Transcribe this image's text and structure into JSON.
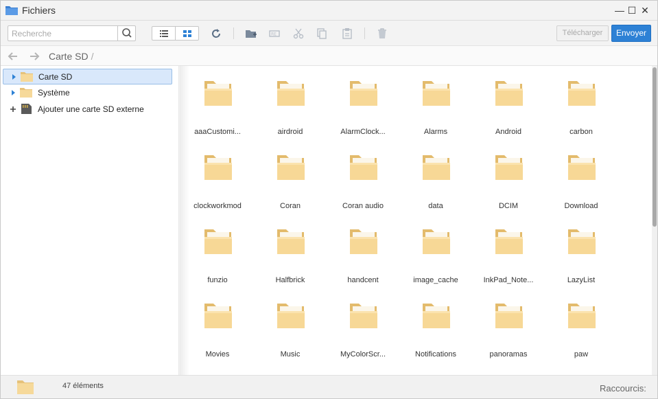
{
  "window": {
    "title": "Fichiers",
    "minimize_label": "—",
    "maximize_label": "☐",
    "close_label": "✕"
  },
  "toolbar": {
    "search_placeholder": "Recherche",
    "view_modes": [
      "list",
      "grid"
    ],
    "active_view": "grid",
    "icons": [
      "search-icon",
      "list-view-icon",
      "grid-view-icon",
      "refresh-icon",
      "new-folder-icon",
      "rename-icon",
      "cut-icon",
      "copy-icon",
      "paste-icon",
      "delete-icon"
    ],
    "download_label": "Télécharger",
    "send_label": "Envoyer",
    "accent_color": "#2d81d5"
  },
  "navbar": {
    "breadcrumb": "Carte SD",
    "separator": "/"
  },
  "sidebar": {
    "items": [
      {
        "label": "Carte SD",
        "selected": true,
        "icon": "folder-icon",
        "toggle": "expand-arrow-icon"
      },
      {
        "label": "Système",
        "selected": false,
        "icon": "folder-icon",
        "toggle": "expand-arrow-icon"
      },
      {
        "label": "Ajouter une carte SD externe",
        "selected": false,
        "icon": "sd-card-icon",
        "toggle": "plus-icon"
      }
    ]
  },
  "folders": [
    {
      "name": "aaaCustomi..."
    },
    {
      "name": "airdroid"
    },
    {
      "name": "AlarmClock..."
    },
    {
      "name": "Alarms"
    },
    {
      "name": "Android"
    },
    {
      "name": "carbon"
    },
    {
      "name": "clockworkmod"
    },
    {
      "name": "Coran"
    },
    {
      "name": "Coran audio"
    },
    {
      "name": "data"
    },
    {
      "name": "DCIM"
    },
    {
      "name": "Download"
    },
    {
      "name": "funzio"
    },
    {
      "name": "Halfbrick"
    },
    {
      "name": "handcent"
    },
    {
      "name": "image_cache"
    },
    {
      "name": "InkPad_Note..."
    },
    {
      "name": "LazyList"
    },
    {
      "name": "Movies"
    },
    {
      "name": "Music"
    },
    {
      "name": "MyColorScr..."
    },
    {
      "name": "Notifications"
    },
    {
      "name": "panoramas"
    },
    {
      "name": "paw"
    }
  ],
  "status": {
    "count": "47 éléments",
    "shortcuts_label": "Raccourcis:"
  }
}
